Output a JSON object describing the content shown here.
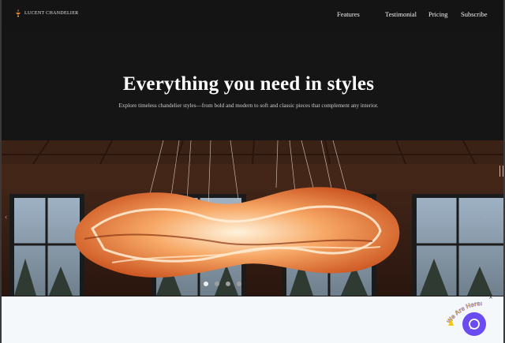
{
  "header": {
    "logo_text": "LUCENT CHANDELIER",
    "nav": [
      {
        "label": "Features"
      },
      {
        "label": "Testimonial"
      },
      {
        "label": "Pricing"
      },
      {
        "label": "Subscribe"
      }
    ]
  },
  "hero": {
    "title": "Everything you need in styles",
    "subtitle": "Explore timeless chandelier styles—from bold and modern to soft and classic pieces that complement any interior."
  },
  "carousel": {
    "slide_count": 4,
    "active_index": 0
  },
  "chat_widget": {
    "badge_text": "We Are Here!",
    "close_symbol": "×"
  },
  "colors": {
    "page_bg": "#151515",
    "accent_chat": "#6a4cf0",
    "badge_yellow": "#f2c811"
  }
}
